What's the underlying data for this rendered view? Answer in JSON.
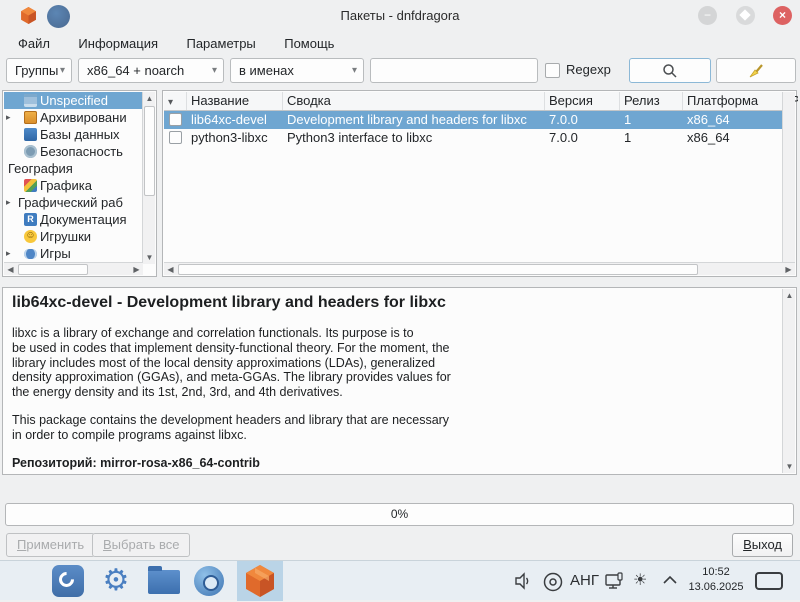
{
  "window": {
    "title": "Пакеты - dnfdragora",
    "minimize_glyph": "−",
    "close_glyph": "×"
  },
  "menu": {
    "items": [
      "Файл",
      "Информация",
      "Параметры",
      "Помощь"
    ]
  },
  "toolbar": {
    "groups_combo": "Группы",
    "arch_combo": "x86_64 + noarch",
    "match_combo": "в именах",
    "search_value": "",
    "regexp_label": "Regexp"
  },
  "sidebar": {
    "items": [
      {
        "label": "Unspecified"
      },
      {
        "label": "Архивировани"
      },
      {
        "label": "Базы данных"
      },
      {
        "label": "Безопасность"
      },
      {
        "label": "География"
      },
      {
        "label": "Графика"
      },
      {
        "label": "Графический раб"
      },
      {
        "label": "Документация"
      },
      {
        "label": "Игрушки"
      },
      {
        "label": "Игры"
      }
    ]
  },
  "table": {
    "columns": [
      "Название",
      "Сводка",
      "Версия",
      "Релиз",
      "Платформа",
      "Р"
    ],
    "rows": [
      {
        "name": "lib64xc-devel",
        "summary": "Development library and headers for libxc",
        "version": "7.0.0",
        "release": "1",
        "platform": "x86_64"
      },
      {
        "name": "python3-libxc",
        "summary": "Python3 interface to libxc",
        "version": "7.0.0",
        "release": "1",
        "platform": "x86_64"
      }
    ]
  },
  "details": {
    "title": "lib64xc-devel - Development library and headers for libxc",
    "paragraph1": "libxc is a library of exchange and correlation functionals. Its purpose is to\nbe used in codes that implement density-functional theory. For the moment, the\nlibrary includes most of the local density approximations (LDAs), generalized\ndensity approximation (GGAs), and meta-GGAs. The library provides values for\nthe energy density and its 1st, 2nd, 3rd, and 4th derivatives.",
    "paragraph2": "This package contains the development headers and library that are necessary\nin order to compile programs against libxc.",
    "repository": "Репозиторий: mirror-rosa-x86_64-contrib"
  },
  "progress": {
    "value": "0%"
  },
  "actions": {
    "apply_mnemonic": "П",
    "apply_rest": "рименить",
    "select_all_mnemonic": "В",
    "select_all_rest": "ыбрать все",
    "quit_mnemonic": "В",
    "quit_rest": "ыход"
  },
  "taskbar": {
    "layout_indicator": "АНГ",
    "clock_time": "10:52",
    "clock_date": "13.06.2025"
  },
  "glyphs": {
    "combo_arrow": "▾",
    "sort_arrow": "▾",
    "expander": "▸",
    "scroll_up": "▲",
    "scroll_down": "▼",
    "scroll_left": "◀",
    "scroll_right": "▶",
    "gear": "⚙",
    "sun": "☀",
    "smiley": "☺",
    "docs_letter": "R"
  },
  "colors": {
    "selection": "#6fa6d1",
    "close_button": "#dd6262",
    "taskbar_active": "#bad4e7",
    "window_bg": "#eff0f1"
  }
}
